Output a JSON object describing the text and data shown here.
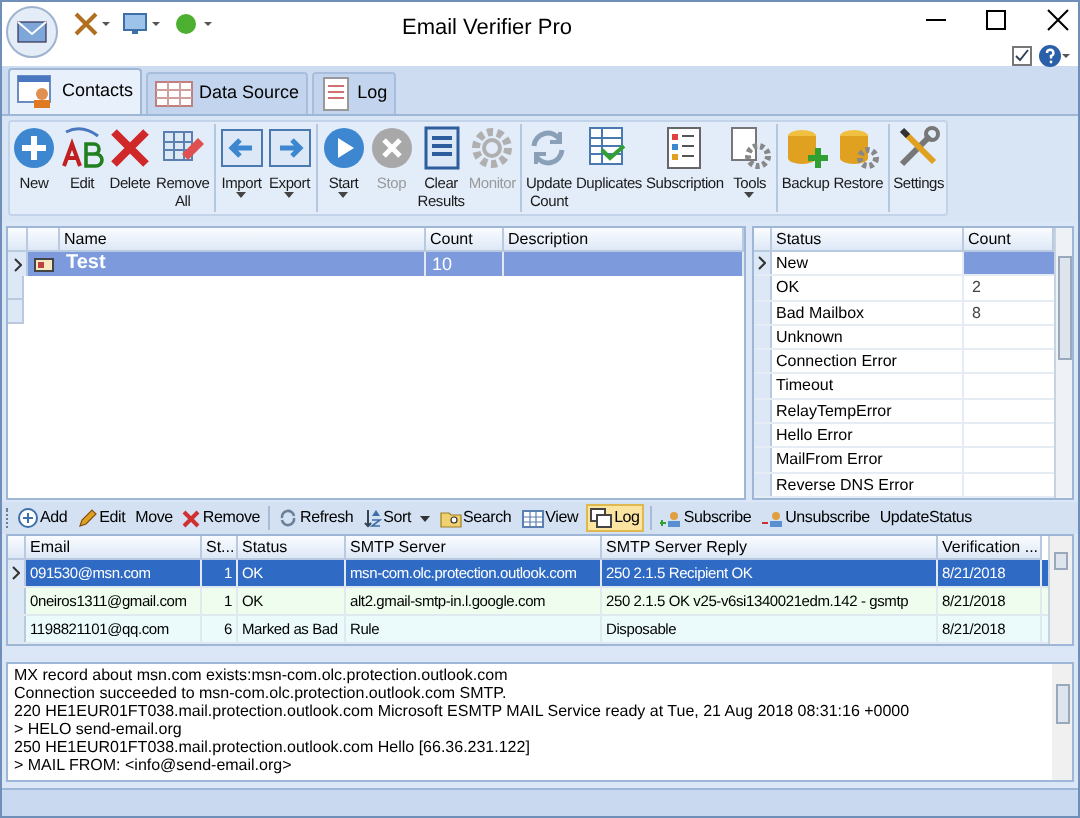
{
  "window": {
    "title": "Email Verifier Pro"
  },
  "tabs": [
    {
      "label": "Contacts",
      "selected": true
    },
    {
      "label": "Data Source",
      "selected": false
    },
    {
      "label": "Log",
      "selected": false
    }
  ],
  "ribbon": {
    "groups": [
      {
        "buttons": [
          {
            "label": "New",
            "disabled": false,
            "dropdown": false
          },
          {
            "label": "Edit",
            "disabled": false,
            "dropdown": false
          },
          {
            "label": "Delete",
            "disabled": false,
            "dropdown": false
          },
          {
            "label": "Remove\nAll",
            "disabled": false,
            "dropdown": false
          }
        ]
      },
      {
        "buttons": [
          {
            "label": "Import",
            "disabled": false,
            "dropdown": true
          },
          {
            "label": "Export",
            "disabled": false,
            "dropdown": true
          }
        ]
      },
      {
        "buttons": [
          {
            "label": "Start",
            "disabled": false,
            "dropdown": true
          },
          {
            "label": "Stop",
            "disabled": true,
            "dropdown": false
          },
          {
            "label": "Clear\nResults",
            "disabled": false,
            "dropdown": false
          },
          {
            "label": "Monitor",
            "disabled": true,
            "dropdown": false
          }
        ]
      },
      {
        "buttons": [
          {
            "label": "Update\nCount",
            "disabled": false,
            "dropdown": false
          },
          {
            "label": "Duplicates",
            "disabled": false,
            "dropdown": false
          },
          {
            "label": "Subscription",
            "disabled": false,
            "dropdown": false
          },
          {
            "label": "Tools",
            "disabled": false,
            "dropdown": true
          }
        ]
      },
      {
        "buttons": [
          {
            "label": "Backup",
            "disabled": false,
            "dropdown": false
          },
          {
            "label": "Restore",
            "disabled": false,
            "dropdown": false
          }
        ]
      },
      {
        "buttons": [
          {
            "label": "Settings",
            "disabled": false,
            "dropdown": false
          }
        ]
      }
    ]
  },
  "lists_table": {
    "columns": [
      "Name",
      "Count",
      "Description"
    ],
    "rows": [
      {
        "name": "Test",
        "count": "10",
        "selected": true
      }
    ]
  },
  "status_table": {
    "columns": [
      "Status",
      "Count"
    ],
    "rows": [
      {
        "status": "New",
        "selected": true
      },
      {
        "status": "OK",
        "count": "2",
        "selected": false
      },
      {
        "status": "Bad Mailbox",
        "count": "8",
        "selected": false
      },
      {
        "status": "Unknown",
        "selected": false
      },
      {
        "status": "Connection Error",
        "selected": false
      },
      {
        "status": "Timeout",
        "selected": false
      },
      {
        "status": "RelayTempError",
        "selected": false
      },
      {
        "status": "Hello Error",
        "selected": false
      },
      {
        "status": "MailFrom Error",
        "selected": false
      },
      {
        "status": "Reverse DNS Error",
        "selected": false
      }
    ]
  },
  "toolbar": [
    {
      "label": "Add",
      "kind": "add",
      "selected": false
    },
    {
      "label": "Edit",
      "kind": "edit",
      "selected": false
    },
    {
      "label": "Move",
      "kind": "plain",
      "selected": false
    },
    {
      "label": "Remove",
      "kind": "remove",
      "selected": false
    },
    {
      "label": "Refresh",
      "kind": "refresh",
      "selected": false
    },
    {
      "label": "Sort",
      "kind": "sort",
      "selected": false
    },
    {
      "label": "Search",
      "kind": "search",
      "selected": false
    },
    {
      "label": "View",
      "kind": "view",
      "selected": false
    },
    {
      "label": "Log",
      "kind": "log",
      "selected": true
    },
    {
      "label": "Subscribe",
      "kind": "subscribe",
      "selected": false
    },
    {
      "label": "Unsubscribe",
      "kind": "unsubscribe",
      "selected": false
    },
    {
      "label": "UpdateStatus",
      "kind": "plain",
      "selected": false
    }
  ],
  "emails_table": {
    "columns": [
      "Email",
      "St...",
      "Status",
      "SMTP Server",
      "SMTP Server Reply",
      "Verification ..."
    ],
    "rows": [
      {
        "cells": [
          "091530@msn.com",
          "1",
          "OK",
          "msn-com.olc.protection.outlook.com",
          "250 2.1.5 Recipient OK",
          "8/21/2018"
        ],
        "selected": true
      },
      {
        "cells": [
          "0neiros1311@gmail.com",
          "1",
          "OK",
          "alt2.gmail-smtp-in.l.google.com",
          "250 2.1.5 OK v25-v6si1340021edm.142 - gsmtp",
          "8/21/2018"
        ],
        "selected": false,
        "color": "#eefdee"
      },
      {
        "cells": [
          "1198821101@qq.com",
          "6",
          "Marked as Bad",
          "Rule",
          "Disposable",
          "8/21/2018"
        ],
        "selected": false,
        "color": "#ebfbfb"
      }
    ]
  },
  "log": [
    "MX record about msn.com exists:msn-com.olc.protection.outlook.com",
    "Connection succeeded to msn-com.olc.protection.outlook.com SMTP.",
    "220 HE1EUR01FT038.mail.protection.outlook.com Microsoft ESMTP MAIL Service ready at Tue, 21 Aug 2018 08:31:16 +0000",
    "> HELO send-email.org",
    "250 HE1EUR01FT038.mail.protection.outlook.com Hello [66.36.231.122]",
    "> MAIL FROM: <info@send-email.org>"
  ]
}
